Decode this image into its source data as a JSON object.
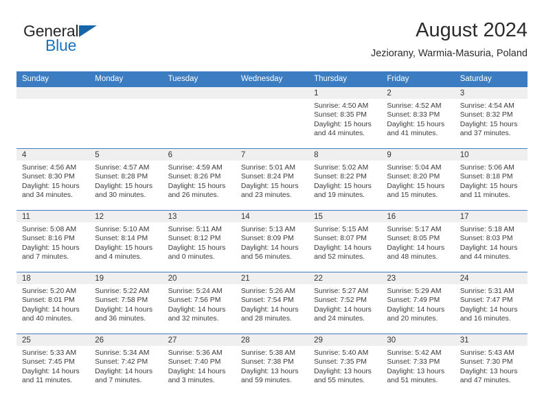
{
  "brand": {
    "name_top": "General",
    "name_bottom": "Blue",
    "triangle_color": "#1565a8",
    "blue_color": "#1b72bd"
  },
  "header": {
    "title": "August 2024",
    "subtitle": "Jeziorany, Warmia-Masuria, Poland"
  },
  "theme": {
    "header_bg": "#3b7dc0",
    "header_text": "#ffffff",
    "row_divider": "#3b7dc0",
    "daynum_band": "#efefef",
    "body_text": "#3a3a3a"
  },
  "calendar": {
    "weekday_headers": [
      "Sunday",
      "Monday",
      "Tuesday",
      "Wednesday",
      "Thursday",
      "Friday",
      "Saturday"
    ],
    "weeks": [
      [
        {
          "day": "",
          "empty": true
        },
        {
          "day": "",
          "empty": true
        },
        {
          "day": "",
          "empty": true
        },
        {
          "day": "",
          "empty": true
        },
        {
          "day": "1",
          "sunrise": "Sunrise: 4:50 AM",
          "sunset": "Sunset: 8:35 PM",
          "daylight_line1": "Daylight: 15 hours",
          "daylight_line2": "and 44 minutes."
        },
        {
          "day": "2",
          "sunrise": "Sunrise: 4:52 AM",
          "sunset": "Sunset: 8:33 PM",
          "daylight_line1": "Daylight: 15 hours",
          "daylight_line2": "and 41 minutes."
        },
        {
          "day": "3",
          "sunrise": "Sunrise: 4:54 AM",
          "sunset": "Sunset: 8:32 PM",
          "daylight_line1": "Daylight: 15 hours",
          "daylight_line2": "and 37 minutes."
        }
      ],
      [
        {
          "day": "4",
          "sunrise": "Sunrise: 4:56 AM",
          "sunset": "Sunset: 8:30 PM",
          "daylight_line1": "Daylight: 15 hours",
          "daylight_line2": "and 34 minutes."
        },
        {
          "day": "5",
          "sunrise": "Sunrise: 4:57 AM",
          "sunset": "Sunset: 8:28 PM",
          "daylight_line1": "Daylight: 15 hours",
          "daylight_line2": "and 30 minutes."
        },
        {
          "day": "6",
          "sunrise": "Sunrise: 4:59 AM",
          "sunset": "Sunset: 8:26 PM",
          "daylight_line1": "Daylight: 15 hours",
          "daylight_line2": "and 26 minutes."
        },
        {
          "day": "7",
          "sunrise": "Sunrise: 5:01 AM",
          "sunset": "Sunset: 8:24 PM",
          "daylight_line1": "Daylight: 15 hours",
          "daylight_line2": "and 23 minutes."
        },
        {
          "day": "8",
          "sunrise": "Sunrise: 5:02 AM",
          "sunset": "Sunset: 8:22 PM",
          "daylight_line1": "Daylight: 15 hours",
          "daylight_line2": "and 19 minutes."
        },
        {
          "day": "9",
          "sunrise": "Sunrise: 5:04 AM",
          "sunset": "Sunset: 8:20 PM",
          "daylight_line1": "Daylight: 15 hours",
          "daylight_line2": "and 15 minutes."
        },
        {
          "day": "10",
          "sunrise": "Sunrise: 5:06 AM",
          "sunset": "Sunset: 8:18 PM",
          "daylight_line1": "Daylight: 15 hours",
          "daylight_line2": "and 11 minutes."
        }
      ],
      [
        {
          "day": "11",
          "sunrise": "Sunrise: 5:08 AM",
          "sunset": "Sunset: 8:16 PM",
          "daylight_line1": "Daylight: 15 hours",
          "daylight_line2": "and 7 minutes."
        },
        {
          "day": "12",
          "sunrise": "Sunrise: 5:10 AM",
          "sunset": "Sunset: 8:14 PM",
          "daylight_line1": "Daylight: 15 hours",
          "daylight_line2": "and 4 minutes."
        },
        {
          "day": "13",
          "sunrise": "Sunrise: 5:11 AM",
          "sunset": "Sunset: 8:12 PM",
          "daylight_line1": "Daylight: 15 hours",
          "daylight_line2": "and 0 minutes."
        },
        {
          "day": "14",
          "sunrise": "Sunrise: 5:13 AM",
          "sunset": "Sunset: 8:09 PM",
          "daylight_line1": "Daylight: 14 hours",
          "daylight_line2": "and 56 minutes."
        },
        {
          "day": "15",
          "sunrise": "Sunrise: 5:15 AM",
          "sunset": "Sunset: 8:07 PM",
          "daylight_line1": "Daylight: 14 hours",
          "daylight_line2": "and 52 minutes."
        },
        {
          "day": "16",
          "sunrise": "Sunrise: 5:17 AM",
          "sunset": "Sunset: 8:05 PM",
          "daylight_line1": "Daylight: 14 hours",
          "daylight_line2": "and 48 minutes."
        },
        {
          "day": "17",
          "sunrise": "Sunrise: 5:18 AM",
          "sunset": "Sunset: 8:03 PM",
          "daylight_line1": "Daylight: 14 hours",
          "daylight_line2": "and 44 minutes."
        }
      ],
      [
        {
          "day": "18",
          "sunrise": "Sunrise: 5:20 AM",
          "sunset": "Sunset: 8:01 PM",
          "daylight_line1": "Daylight: 14 hours",
          "daylight_line2": "and 40 minutes."
        },
        {
          "day": "19",
          "sunrise": "Sunrise: 5:22 AM",
          "sunset": "Sunset: 7:58 PM",
          "daylight_line1": "Daylight: 14 hours",
          "daylight_line2": "and 36 minutes."
        },
        {
          "day": "20",
          "sunrise": "Sunrise: 5:24 AM",
          "sunset": "Sunset: 7:56 PM",
          "daylight_line1": "Daylight: 14 hours",
          "daylight_line2": "and 32 minutes."
        },
        {
          "day": "21",
          "sunrise": "Sunrise: 5:26 AM",
          "sunset": "Sunset: 7:54 PM",
          "daylight_line1": "Daylight: 14 hours",
          "daylight_line2": "and 28 minutes."
        },
        {
          "day": "22",
          "sunrise": "Sunrise: 5:27 AM",
          "sunset": "Sunset: 7:52 PM",
          "daylight_line1": "Daylight: 14 hours",
          "daylight_line2": "and 24 minutes."
        },
        {
          "day": "23",
          "sunrise": "Sunrise: 5:29 AM",
          "sunset": "Sunset: 7:49 PM",
          "daylight_line1": "Daylight: 14 hours",
          "daylight_line2": "and 20 minutes."
        },
        {
          "day": "24",
          "sunrise": "Sunrise: 5:31 AM",
          "sunset": "Sunset: 7:47 PM",
          "daylight_line1": "Daylight: 14 hours",
          "daylight_line2": "and 16 minutes."
        }
      ],
      [
        {
          "day": "25",
          "sunrise": "Sunrise: 5:33 AM",
          "sunset": "Sunset: 7:45 PM",
          "daylight_line1": "Daylight: 14 hours",
          "daylight_line2": "and 11 minutes."
        },
        {
          "day": "26",
          "sunrise": "Sunrise: 5:34 AM",
          "sunset": "Sunset: 7:42 PM",
          "daylight_line1": "Daylight: 14 hours",
          "daylight_line2": "and 7 minutes."
        },
        {
          "day": "27",
          "sunrise": "Sunrise: 5:36 AM",
          "sunset": "Sunset: 7:40 PM",
          "daylight_line1": "Daylight: 14 hours",
          "daylight_line2": "and 3 minutes."
        },
        {
          "day": "28",
          "sunrise": "Sunrise: 5:38 AM",
          "sunset": "Sunset: 7:38 PM",
          "daylight_line1": "Daylight: 13 hours",
          "daylight_line2": "and 59 minutes."
        },
        {
          "day": "29",
          "sunrise": "Sunrise: 5:40 AM",
          "sunset": "Sunset: 7:35 PM",
          "daylight_line1": "Daylight: 13 hours",
          "daylight_line2": "and 55 minutes."
        },
        {
          "day": "30",
          "sunrise": "Sunrise: 5:42 AM",
          "sunset": "Sunset: 7:33 PM",
          "daylight_line1": "Daylight: 13 hours",
          "daylight_line2": "and 51 minutes."
        },
        {
          "day": "31",
          "sunrise": "Sunrise: 5:43 AM",
          "sunset": "Sunset: 7:30 PM",
          "daylight_line1": "Daylight: 13 hours",
          "daylight_line2": "and 47 minutes."
        }
      ]
    ]
  }
}
